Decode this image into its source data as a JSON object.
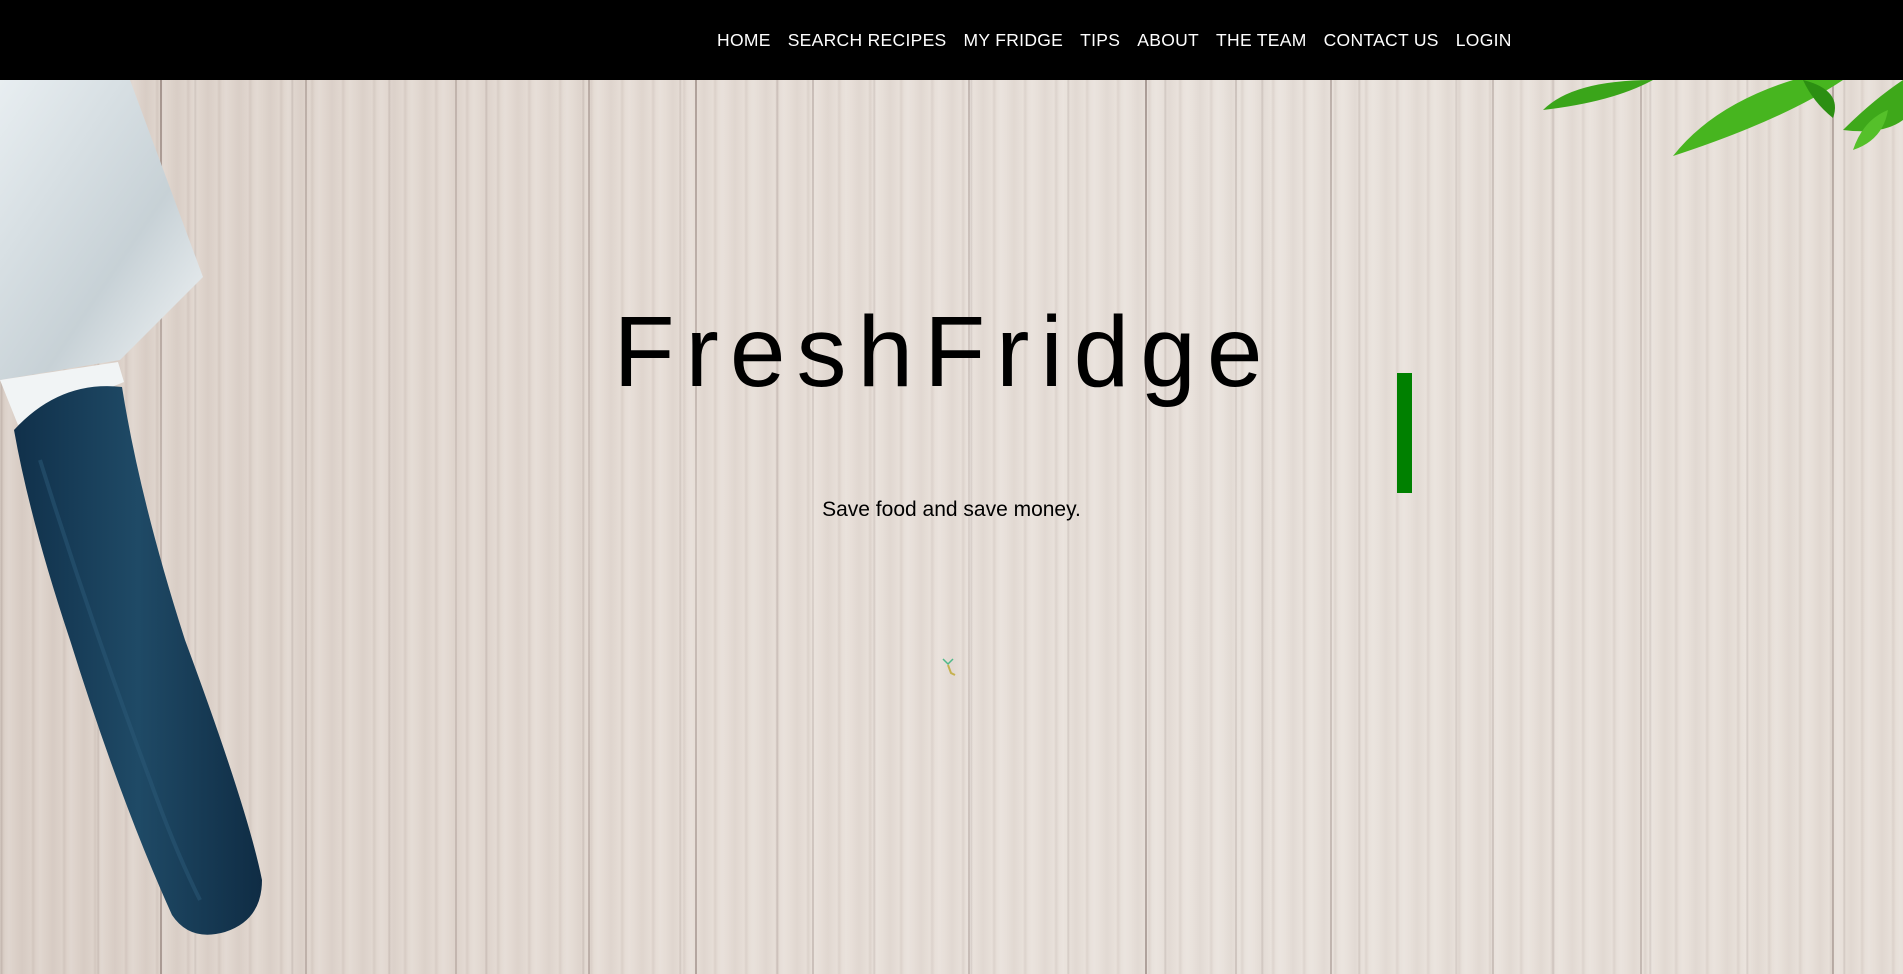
{
  "nav": {
    "items": [
      {
        "label": "HOME"
      },
      {
        "label": "SEARCH RECIPES"
      },
      {
        "label": "MY FRIDGE"
      },
      {
        "label": "TIPS"
      },
      {
        "label": "ABOUT"
      },
      {
        "label": "THE TEAM"
      },
      {
        "label": "CONTACT US"
      },
      {
        "label": "LOGIN"
      }
    ]
  },
  "hero": {
    "title": "FreshFridge",
    "tagline": "Save food and save money."
  },
  "colors": {
    "navbar_bg": "#000000",
    "nav_text": "#ffffff",
    "cursor_accent": "#008000",
    "knife_handle": "#173c55",
    "leaf_green": "#3aa51a"
  },
  "icons": {
    "scroll": "chevron-down-icon"
  }
}
